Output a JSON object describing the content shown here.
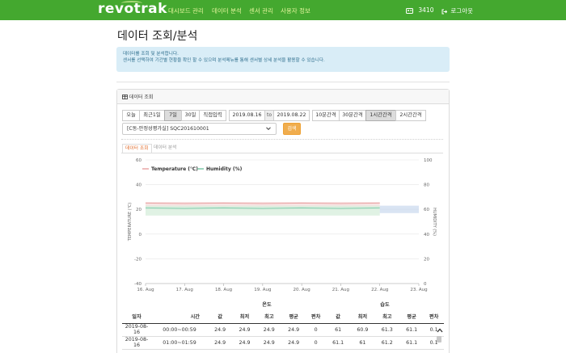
{
  "navbar": {
    "brand": "revotrak",
    "items": [
      "대시보드 관리",
      "데이터 분석",
      "센서 관리",
      "사용자 정보"
    ],
    "count": "3410",
    "logout": "로그아웃"
  },
  "page": {
    "title": "데이터 조회/분석",
    "info_line1": "데이터를 조회 및 분석합니다.",
    "info_line2": "센서를 선택하여 기간별 현황을 확인 할 수 있으며 분석메뉴를 통해 센서별 상세 분석을 활용할 수 있습니다."
  },
  "panel": {
    "title": "데이터 조회",
    "period_buttons": [
      "오늘",
      "최근1일",
      "7일",
      "30일",
      "직접입력"
    ],
    "active_period": "7일",
    "date_from": "2019.08.16",
    "date_sep": "to",
    "date_to": "2019.08.22",
    "interval_buttons": [
      "10분간격",
      "30분간격",
      "1시간간격",
      "2시간간격"
    ],
    "active_interval": "1시간간격",
    "sensor_select": "[C동-안정성평가실] SQC201610001",
    "search_label": "검색",
    "tabs": [
      "데이터 조회",
      "데이터 분석"
    ]
  },
  "colors": {
    "nav": "#44a82f",
    "temperature": "#e8a5a5",
    "humidity": "#7cc9a8",
    "accent": "#f0ad4e"
  },
  "chart_data": {
    "type": "line",
    "x": [
      "16. Aug",
      "17. Aug",
      "18. Aug",
      "19. Aug",
      "20. Aug",
      "21. Aug",
      "22. Aug",
      "23. Aug"
    ],
    "series": [
      {
        "name": "Temperature (℃)",
        "values": [
          24.9,
          24.9,
          24.9,
          24.9,
          24.9,
          24.9,
          24.9
        ],
        "axis": "left"
      },
      {
        "name": "Humidity (%)",
        "values": [
          61,
          61,
          61,
          61,
          61,
          61,
          61
        ],
        "axis": "right"
      }
    ],
    "left_axis": {
      "label": "TEMPERATURE (℃)",
      "ticks": [
        "60",
        "40",
        "20",
        "0",
        "-20",
        "-40"
      ],
      "ylim": [
        -40,
        60
      ]
    },
    "right_axis": {
      "label": "HUMIDITY (%)",
      "ticks": [
        "100",
        "80",
        "60",
        "40",
        "20",
        "0"
      ],
      "ylim": [
        0,
        100
      ]
    },
    "legend_position": "top-left",
    "grid": true
  },
  "table": {
    "group_headers": {
      "temp": "온도",
      "humid": "습도"
    },
    "columns": [
      "일자",
      "시간",
      "값",
      "최저",
      "최고",
      "평균",
      "편차",
      "값",
      "최저",
      "최고",
      "평균",
      "편차"
    ],
    "rows": [
      [
        "2019-08-16",
        "00:00~00:59",
        "24.9",
        "24.9",
        "24.9",
        "24.9",
        "0",
        "61",
        "60.9",
        "61.3",
        "61.1",
        "0.1"
      ],
      [
        "2019-08-16",
        "01:00~01:59",
        "24.9",
        "24.9",
        "24.9",
        "24.9",
        "0",
        "61.1",
        "61",
        "61.2",
        "61.1",
        "0.1"
      ]
    ]
  }
}
